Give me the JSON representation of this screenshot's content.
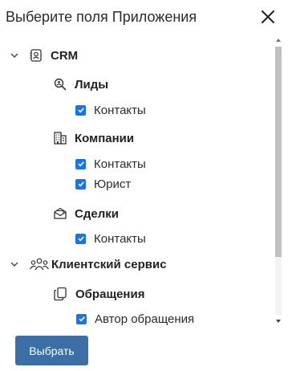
{
  "dialog": {
    "title": "Выберите поля Приложения",
    "submit_label": "Выбрать"
  },
  "tree": {
    "crm": {
      "label": "CRM",
      "leads": {
        "label": "Лиды",
        "fields": [
          "Контакты"
        ]
      },
      "companies": {
        "label": "Компании",
        "fields": [
          "Контакты",
          "Юрист"
        ]
      },
      "deals": {
        "label": "Сделки",
        "fields": [
          "Контакты"
        ]
      }
    },
    "client_service": {
      "label": "Клиентский сервис",
      "requests": {
        "label": "Обращения",
        "fields": [
          "Автор обращения"
        ]
      }
    }
  },
  "colors": {
    "checkbox": "#1a73e8",
    "button": "#3b6fa6"
  },
  "icons": [
    "close-icon",
    "chevron-down-icon",
    "contact-card-icon",
    "search-user-icon",
    "building-icon",
    "envelope-icon",
    "people-icon",
    "documents-icon",
    "checkmark-icon"
  ]
}
